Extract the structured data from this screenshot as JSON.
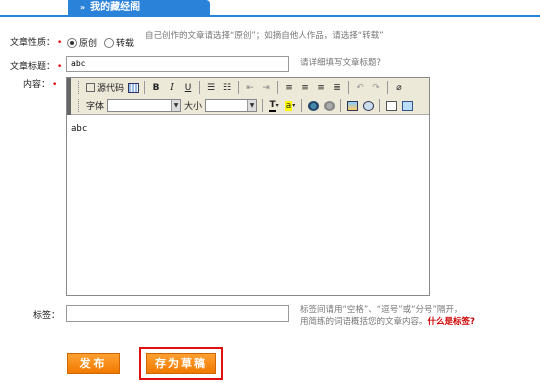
{
  "tab": {
    "title": "我的藏经阁"
  },
  "form": {
    "type": {
      "label": "文章性质：",
      "options": [
        "原创",
        "转载"
      ],
      "selected": "原创",
      "hint": "自己创作的文章请选择“原创”；如摘自他人作品，请选择“转载”"
    },
    "title": {
      "label": "文章标题：",
      "value": "abc",
      "hint": "请详细填写文章标题?"
    },
    "content": {
      "label": "内容：",
      "value": "abc"
    },
    "tags": {
      "label": "标签：",
      "value": "",
      "hint_line1": "标签间请用“空格”、“逗号”或“分号”隔开，",
      "hint_line2": "用简练的词语概括您的文章内容。",
      "hint_link": "什么是标签?"
    }
  },
  "toolbar": {
    "source_label": "源代码",
    "bold": "B",
    "italic": "I",
    "underline": "U",
    "font_label": "字体",
    "size_label": "大小",
    "text_color": "T",
    "bg_color": "a"
  },
  "buttons": {
    "publish": "发布",
    "save_draft": "存为草稿"
  },
  "colors": {
    "accent": "#2b82d9",
    "button": "#f07a00",
    "highlight": "#e01010"
  }
}
